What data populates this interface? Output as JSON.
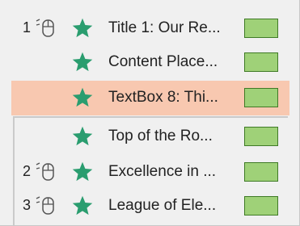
{
  "rows": [
    {
      "num": "1",
      "title": "Title 1: Our Re...",
      "has_trigger": true,
      "selected": false
    },
    {
      "num": "",
      "title": "Content Place...",
      "has_trigger": false,
      "selected": false
    },
    {
      "num": "",
      "title": "TextBox 8: Thi...",
      "has_trigger": false,
      "selected": true
    },
    {
      "num": "",
      "title": "Top of the Ro...",
      "has_trigger": false,
      "selected": false
    },
    {
      "num": "2",
      "title": "Excellence in ...",
      "has_trigger": true,
      "selected": false
    },
    {
      "num": "3",
      "title": "League of Ele...",
      "has_trigger": true,
      "selected": false
    }
  ],
  "colors": {
    "star": "#2a9d6f",
    "swatch_fill": "#9fd178",
    "swatch_border": "#3f7a26",
    "selected_bg": "#f8c8b0",
    "pane_bg": "#f0f0f0"
  },
  "icons": {
    "trigger": "mouse-click-icon",
    "effect": "star-icon",
    "timing": "green-swatch-icon"
  }
}
